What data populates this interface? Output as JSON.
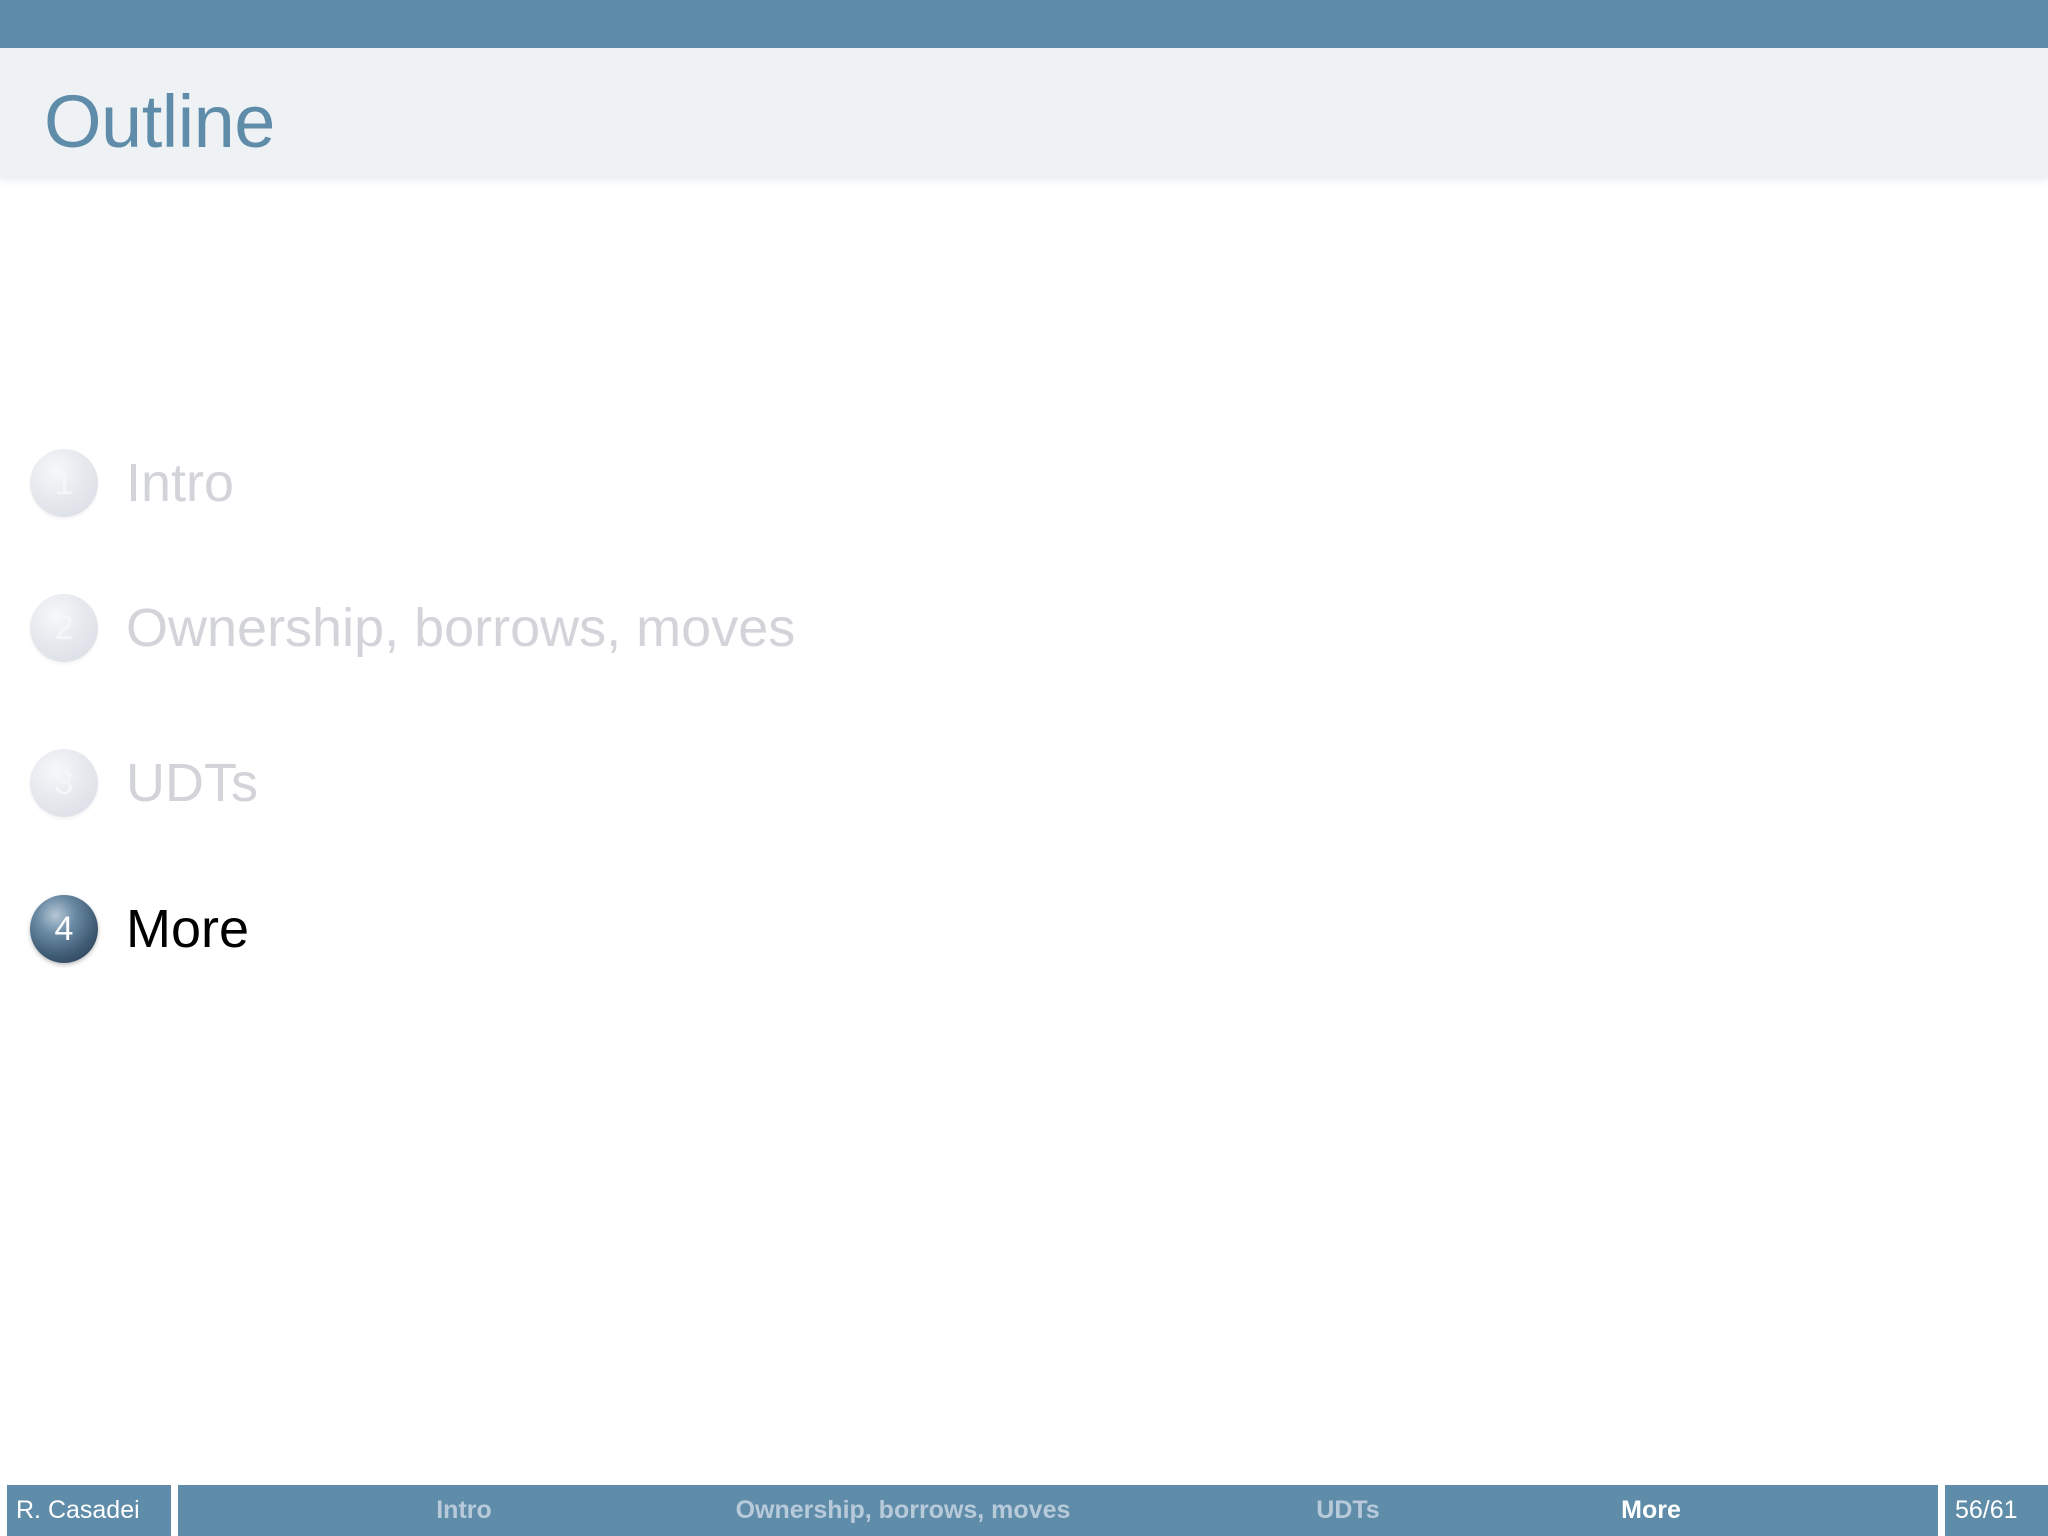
{
  "header": {
    "title": "Outline"
  },
  "toc": {
    "items": [
      {
        "number": "1",
        "label": "Intro",
        "state": "inactive"
      },
      {
        "number": "2",
        "label": "Ownership, borrows, moves",
        "state": "inactive"
      },
      {
        "number": "3",
        "label": "UDTs",
        "state": "inactive"
      },
      {
        "number": "4",
        "label": "More",
        "state": "active"
      }
    ]
  },
  "footer": {
    "author": "R. Casadei",
    "sections": [
      {
        "label": "Intro",
        "current": false
      },
      {
        "label": "Ownership, borrows, moves",
        "current": false
      },
      {
        "label": "UDTs",
        "current": false
      },
      {
        "label": "More",
        "current": true
      }
    ],
    "page": "56/61"
  },
  "colors": {
    "accent": "#5f8ca9",
    "title_band": "#eff2f5",
    "inactive_text": "#d2d4d9",
    "active_ball": "#3e5a73"
  }
}
